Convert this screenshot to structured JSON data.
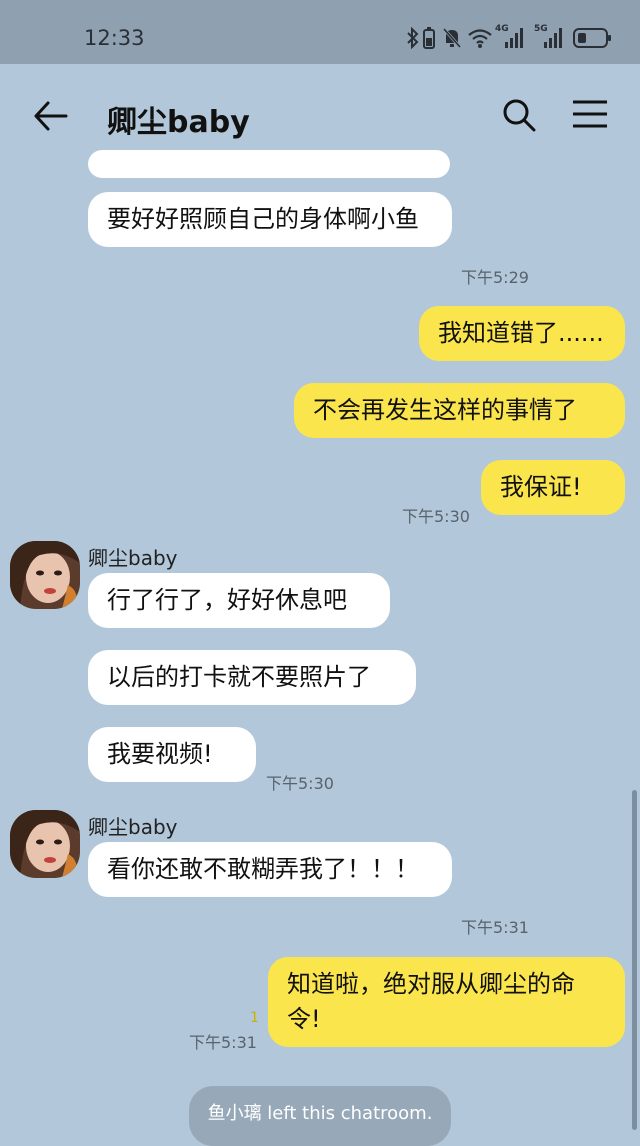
{
  "status_bar": {
    "time": "12:33",
    "signal_1_label": "4G",
    "signal_2_label": "5G",
    "icons": [
      "bluetooth-icon",
      "battery-saver-icon",
      "mute-icon",
      "wifi-icon",
      "signal-4g-icon",
      "signal-5g-icon",
      "battery-icon"
    ]
  },
  "header": {
    "title": "卿尘baby",
    "back_icon": "arrow-left-icon",
    "search_icon": "search-icon",
    "menu_icon": "hamburger-menu-icon"
  },
  "messages": [
    {
      "side": "in",
      "text": "要好好照顾自己的身体啊小鱼",
      "time": "下午5:29"
    },
    {
      "side": "out",
      "text": "我知道错了......"
    },
    {
      "side": "out",
      "text": "不会再发生这样的事情了"
    },
    {
      "side": "out",
      "text": "我保证!",
      "time": "下午5:30"
    },
    {
      "side": "in",
      "sender": "卿尘baby",
      "text": "行了行了，好好休息吧"
    },
    {
      "side": "in",
      "text": "以后的打卡就不要照片了"
    },
    {
      "side": "in",
      "text": "我要视频!",
      "time": "下午5:30"
    },
    {
      "side": "in",
      "sender": "卿尘baby",
      "text": "看你还敢不敢糊弄我了！！！",
      "time": "下午5:31"
    },
    {
      "side": "out",
      "text": "知道啦，绝对服从卿尘的命令!",
      "time": "下午5:31",
      "unread": "1"
    }
  ],
  "system_message": "鱼小璃 left this chatroom.",
  "colors": {
    "background": "#b2c7d9",
    "status_bar": "#8fa1b1",
    "incoming_bubble": "#ffffff",
    "outgoing_bubble": "#fbe54d"
  }
}
